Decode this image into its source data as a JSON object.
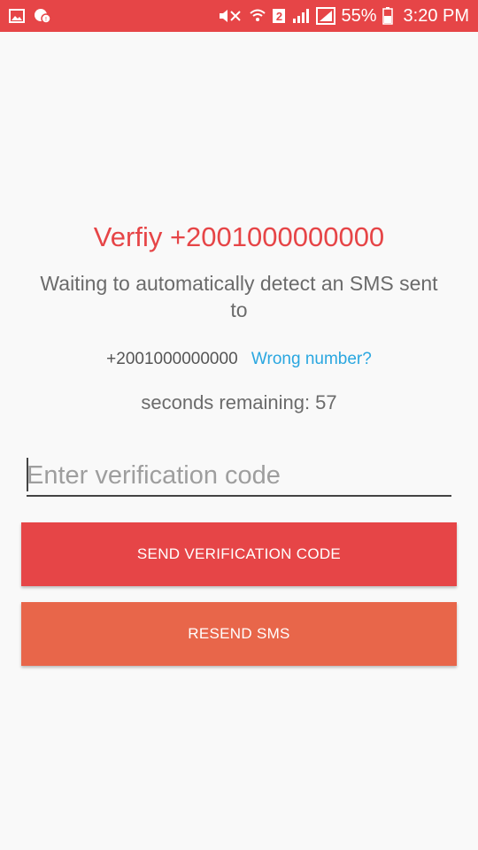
{
  "status_bar": {
    "battery_percent": "55%",
    "time": "3:20 PM",
    "sim_badge": "2",
    "icons": [
      "gallery-icon",
      "notification-icon",
      "mute-icon",
      "wifi-icon",
      "signal-icon",
      "battery-icon"
    ],
    "background": "#e64547"
  },
  "verify": {
    "title": "Verfiy +2001000000000",
    "waiting_text": "Waiting to automatically detect an SMS sent to",
    "phone_number": "+2001000000000",
    "wrong_number": "Wrong number?",
    "seconds_label": "seconds remaining:",
    "seconds_value": "57"
  },
  "code_input": {
    "placeholder": "Enter verification code",
    "value": ""
  },
  "buttons": {
    "send_label": "SEND VERIFICATION CODE",
    "resend_label": "RESEND SMS"
  },
  "colors": {
    "accent": "#e64547",
    "resend": "#e8664a",
    "link": "#2aa7e0"
  }
}
